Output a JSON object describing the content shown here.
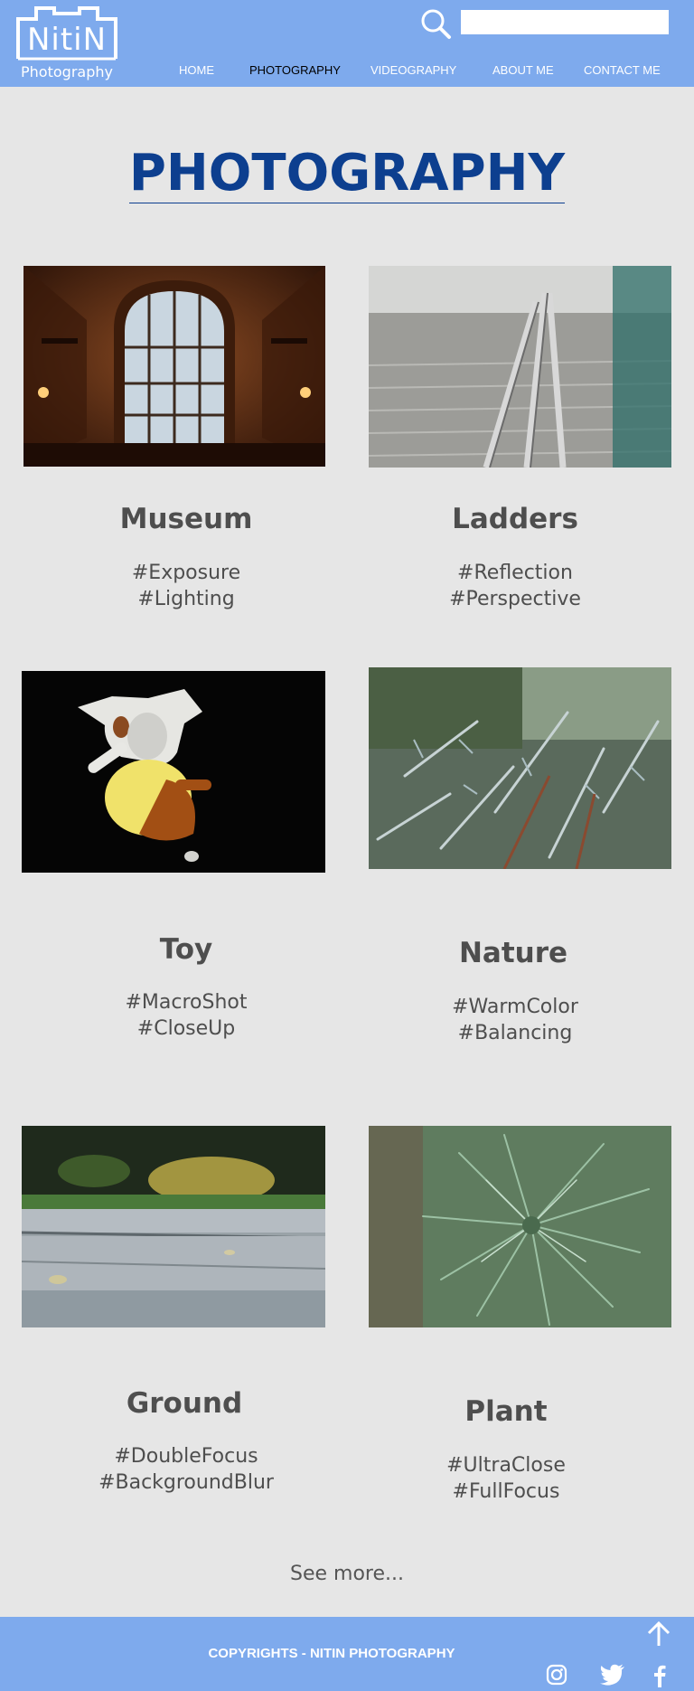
{
  "brand": {
    "name": "NitiN",
    "tagline": "Photography"
  },
  "search": {
    "placeholder": "",
    "value": ""
  },
  "nav": [
    {
      "label": "HOME"
    },
    {
      "label": "PHOTOGRAPHY"
    },
    {
      "label": "VIDEOGRAPHY"
    },
    {
      "label": "ABOUT ME"
    },
    {
      "label": "CONTACT ME"
    }
  ],
  "page": {
    "title": "PHOTOGRAPHY"
  },
  "cards": [
    {
      "title": "Museum",
      "tags": [
        "#Exposure",
        "#Lighting"
      ]
    },
    {
      "title": "Ladders",
      "tags": [
        "#Reflection",
        "#Perspective"
      ]
    },
    {
      "title": "Toy",
      "tags": [
        "#MacroShot",
        "#CloseUp"
      ]
    },
    {
      "title": "Nature",
      "tags": [
        "#WarmColor",
        "#Balancing"
      ]
    },
    {
      "title": "Ground",
      "tags": [
        "#DoubleFocus",
        "#BackgroundBlur"
      ]
    },
    {
      "title": "Plant",
      "tags": [
        "#UltraClose",
        "#FullFocus"
      ]
    }
  ],
  "see_more": "See more...",
  "footer": {
    "copyright": "COPYRIGHTS - NITIN PHOTOGRAPHY",
    "icons": [
      "arrow-up-icon",
      "instagram-icon",
      "twitter-icon",
      "facebook-icon"
    ]
  },
  "colors": {
    "header_bg": "#7eaaed",
    "title": "#0d3f8f",
    "page_bg": "#e6e6e6"
  }
}
